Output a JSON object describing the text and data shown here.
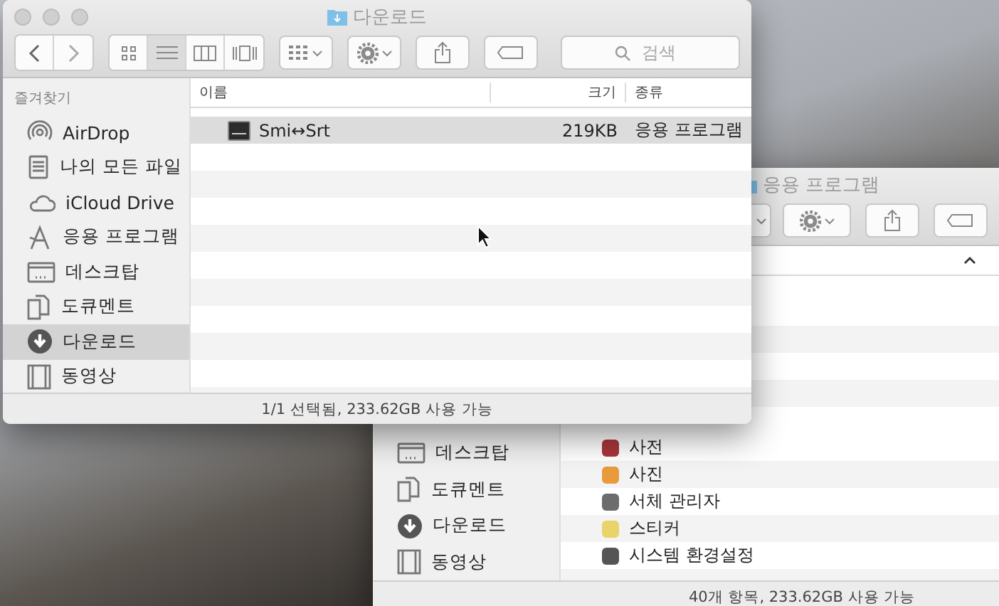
{
  "front_window": {
    "title": "다운로드",
    "toolbar": {
      "views": [
        {
          "selected": false
        },
        {
          "selected": true
        },
        {
          "selected": false
        },
        {
          "selected": false
        }
      ],
      "search_placeholder": "검색"
    },
    "sidebar": {
      "heading": "즐겨찾기",
      "items": [
        {
          "label": "AirDrop",
          "selected": false
        },
        {
          "label": "나의 모든 파일",
          "selected": false
        },
        {
          "label": "iCloud Drive",
          "selected": false
        },
        {
          "label": "응용 프로그램",
          "selected": false
        },
        {
          "label": "데스크탑",
          "selected": false
        },
        {
          "label": "도큐멘트",
          "selected": false
        },
        {
          "label": "다운로드",
          "selected": true
        },
        {
          "label": "동영상",
          "selected": false
        }
      ]
    },
    "table": {
      "columns": [
        "이름",
        "크기",
        "종류"
      ],
      "rows": [
        {
          "name": "Smi↔Srt",
          "size": "219KB",
          "kind": "응용 프로그램",
          "selected": true
        }
      ]
    },
    "status_bar": "1/1 선택됨, 233.62GB 사용 가능"
  },
  "back_window": {
    "title": "응용 프로그램",
    "sidebar": {
      "items": [
        {
          "label": "데스크탑"
        },
        {
          "label": "도큐멘트"
        },
        {
          "label": "다운로드"
        },
        {
          "label": "동영상"
        }
      ]
    },
    "list": {
      "rows": [
        {
          "name": "사전"
        },
        {
          "name": "사진"
        },
        {
          "name": "서체 관리자"
        },
        {
          "name": "스티커"
        },
        {
          "name": "시스템 환경설정"
        }
      ]
    },
    "status_bar": "40개 항목, 233.62GB 사용 가능"
  }
}
